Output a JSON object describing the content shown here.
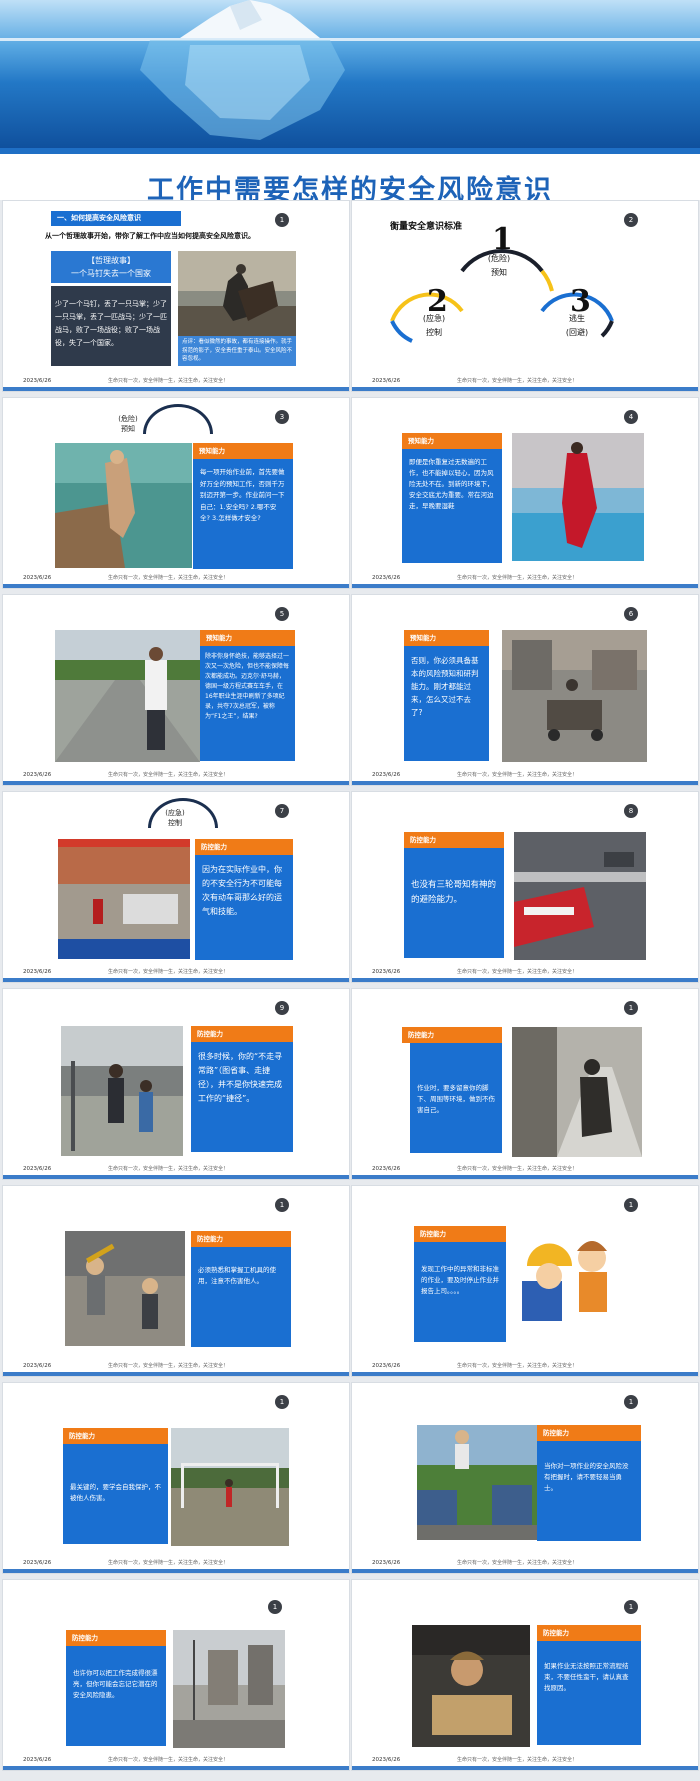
{
  "banner": {
    "title": "工作中需要怎样的安全风险意识"
  },
  "footer": {
    "date": "2023/6/26",
    "motto": "生命只有一次，安全伴随一生，关注生命，关注安全！"
  },
  "slides": {
    "s1": {
      "num": "1",
      "section": "一、如何提高安全风险意识",
      "intro": "从一个哲理故事开始，带你了解工作中应当如何提高安全风险意识。",
      "story_title": "【哲理故事】",
      "story_name": "一个马钉失去一个国家",
      "story_text": "少了一个马钉，丢了一只马掌；少了一只马掌，丢了一匹战马；少了一匹战马，败了一场战役；败了一场战役，失了一个国家。",
      "caption": "点评：看似微然的事故，都有连接操作。就手拐范的影子，安全责任重于泰山。安全风险不容忽视。"
    },
    "s2": {
      "num": "2",
      "title": "衡量安全意识标准",
      "n1": "1",
      "l1a": "(危险)",
      "l1b": "预知",
      "n2": "2",
      "l2a": "(应急)",
      "l2b": "控制",
      "n3": "3",
      "l3a": "逃生",
      "l3b": "(回避)"
    },
    "s3": {
      "num": "3",
      "arch_a": "(危险)",
      "arch_b": "预知",
      "box": "预知能力",
      "text": "每一项开始作业前，首先要做好万全的预知工作，否则千万别迈开第一步。作业前问一下自己：1.安全吗? 2.哪不安全? 3.怎样做才安全?"
    },
    "s4": {
      "num": "4",
      "box": "预知能力",
      "text": "即便是你重复过无数遍的工作，也不能掉以轻心，因为风险无处不在。到新的环境下，安全交底尤为重要。常在河边走，早晚要湿鞋"
    },
    "s5": {
      "num": "5",
      "box": "预知能力",
      "text": "除非你身怀绝技，能够选择过一次又一次危险，但也不能保障每次都能成功。迈克尔·舒马赫，德国一级方程式赛车车手，在16年职业生涯中刷新了多项纪录，共夺7次总冠军，被称为“F1之王”，结果?"
    },
    "s6": {
      "num": "6",
      "box": "预知能力",
      "text": "否则，你必须具备基本的风险预知和研判能力。刚才都能过来，怎么又过不去了?"
    },
    "s7": {
      "num": "7",
      "arch_a": "(应急)",
      "arch_b": "控制",
      "box": "防控能力",
      "text": "因为在实际作业中，你的不安全行为不可能每次有动车哥那么好的运气和技能。"
    },
    "s8": {
      "num": "8",
      "box": "防控能力",
      "text": "也没有三轮哥知有神的的避险能力。"
    },
    "s9": {
      "num": "9",
      "box": "防控能力",
      "text": "很多时候，你的“不走寻常路”（图省事、走捷径），并不是你快速完成工作的“捷径”。"
    },
    "s10": {
      "num": "1",
      "box": "防控能力",
      "text": "作业时，要多留意你的脚下、周围等环境，做到不伤害自己。"
    },
    "s11": {
      "num": "1",
      "box": "防控能力",
      "text": "必须熟悉和掌握工机具的使用，注意不伤害他人。"
    },
    "s12": {
      "num": "1",
      "box": "防控能力",
      "text": "发现工作中的异常和非标准的作业，要及时停止作业并报告上司。。。。"
    },
    "s13": {
      "num": "1",
      "box": "防控能力",
      "text": "最关键的，要学会自我保护，不被他人伤害。"
    },
    "s14": {
      "num": "1",
      "box": "防控能力",
      "text": "当你对一项作业的安全风险没有把握时，请不要轻易当勇士。"
    },
    "s15": {
      "num": "1",
      "box": "防控能力",
      "text": "也许你可以把工作完成得很漂亮，但你可能会忘记它潜在的安全风险隐患。"
    },
    "s16": {
      "num": "1",
      "box": "防控能力",
      "text": "如果作业无法按照正常流程结束，不要任性蛮干，请认真查找原因。"
    }
  },
  "colors": {
    "orange": "#f07b17",
    "blue": "#1a6fd1",
    "title_blue": "#1d63b8"
  }
}
